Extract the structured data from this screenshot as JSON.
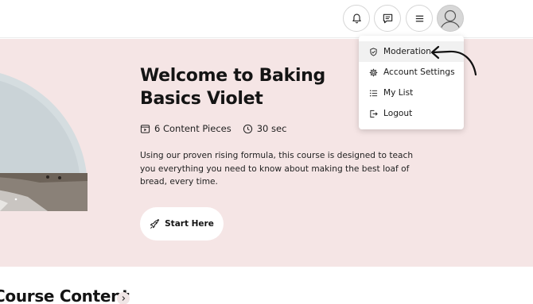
{
  "header": {
    "notifications_icon": "bell-icon",
    "messages_icon": "chat-icon",
    "menu_icon": "hamburger-icon",
    "avatar_icon": "user-avatar-icon"
  },
  "hero": {
    "title": "Welcome to Baking Basics Violet",
    "content_pieces": "6 Content Pieces",
    "duration": "30 sec",
    "description": "Using our proven rising formula, this course is designed to teach you everything you need to know about making the best loaf of bread, every time.",
    "start_button": "Start Here"
  },
  "section": {
    "title": "Course Content"
  },
  "dropdown": {
    "items": [
      {
        "label": "Moderation",
        "icon": "shield-check-icon"
      },
      {
        "label": "Account Settings",
        "icon": "gear-icon"
      },
      {
        "label": "My List",
        "icon": "list-icon"
      },
      {
        "label": "Logout",
        "icon": "logout-icon"
      }
    ]
  },
  "colors": {
    "hero_background": "#f5e5e5",
    "header_background": "#ffffff",
    "text": "#141414",
    "menu_highlight": "#f1f1f1"
  }
}
